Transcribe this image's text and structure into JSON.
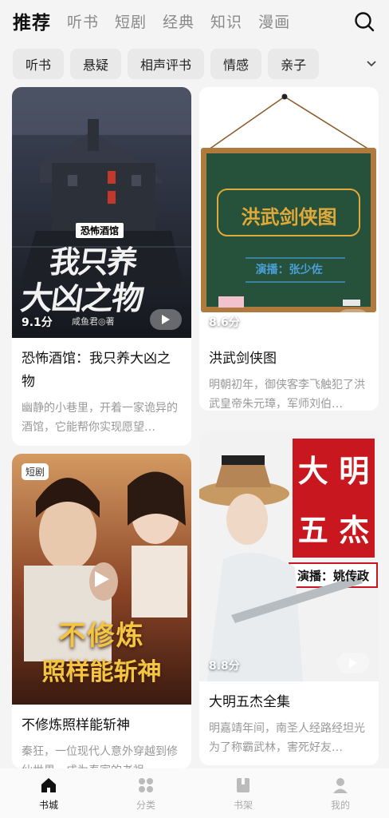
{
  "top_tabs": [
    "推荐",
    "听书",
    "短剧",
    "经典",
    "知识",
    "漫画"
  ],
  "chips": [
    "听书",
    "悬疑",
    "相声评书",
    "情感",
    "亲子"
  ],
  "cards": [
    {
      "title": "恐怖酒馆：我只养大凶之物",
      "desc": "幽静的小巷里，开着一家诡异的酒馆，它能帮你实现愿望…",
      "rating": "9.1分",
      "cover_text": {
        "series": "恐怖酒馆",
        "line1": "我只养",
        "line2": "大凶之物",
        "author": "咸鱼君◎著"
      }
    },
    {
      "title": "洪武剑侠图",
      "desc": "明朝初年，御侠客李飞触犯了洪武皇帝朱元璋，军师刘伯…",
      "rating": "8.6分",
      "cover_text": {
        "title": "洪武剑侠图",
        "narrator": "演播：张少佐"
      }
    },
    {
      "title": "不修炼照样能斩神",
      "desc": "秦狂，一位现代人意外穿越到修仙世界，成为秦家的老祖…",
      "badge": "短剧",
      "cover_text": {
        "line1": "不修炼",
        "line2": "照样能斩神"
      }
    },
    {
      "title": "大明五杰全集",
      "desc": "明嘉靖年间，南圣人经路经坦光为了称霸武林，害死好友…",
      "rating": "8.8分",
      "cover_text": {
        "chars": [
          "大",
          "明",
          "五",
          "杰"
        ],
        "narrator": "演播：姚传政"
      }
    }
  ],
  "bottom_nav": [
    {
      "label": "书城",
      "icon": "home-icon"
    },
    {
      "label": "分类",
      "icon": "category-icon"
    },
    {
      "label": "书架",
      "icon": "bookshelf-icon"
    },
    {
      "label": "我的",
      "icon": "profile-icon"
    }
  ],
  "colors": {
    "accent": "#111111",
    "inactive": "#8a8a8a",
    "chip_bg": "#e9e9e9",
    "background": "#f4f4f4"
  }
}
